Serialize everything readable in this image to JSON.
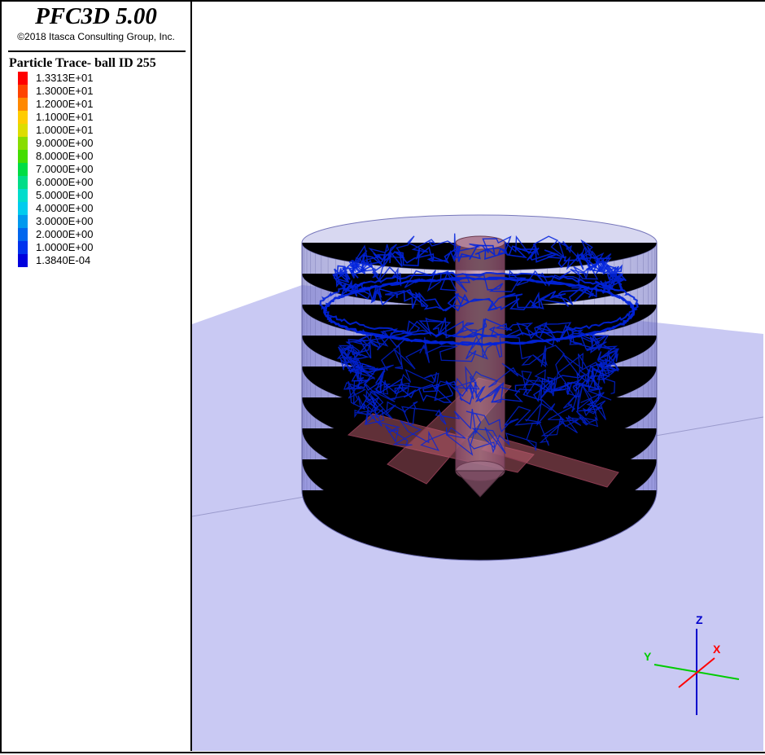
{
  "header": {
    "app_title": "PFC3D 5.00",
    "copyright": "©2018 Itasca Consulting Group, Inc."
  },
  "legend": {
    "title": "Particle Trace- ball  ID 255",
    "entries": [
      {
        "label": "1.3313E+01",
        "color": "#ff0000"
      },
      {
        "label": "1.3000E+01",
        "color": "#ff4400"
      },
      {
        "label": "1.2000E+01",
        "color": "#ff8800"
      },
      {
        "label": "1.1000E+01",
        "color": "#ffcc00"
      },
      {
        "label": "1.0000E+01",
        "color": "#dddd00"
      },
      {
        "label": "9.0000E+00",
        "color": "#88dd00"
      },
      {
        "label": "8.0000E+00",
        "color": "#44dd00"
      },
      {
        "label": "7.0000E+00",
        "color": "#00dd44"
      },
      {
        "label": "6.0000E+00",
        "color": "#00dd88"
      },
      {
        "label": "5.0000E+00",
        "color": "#00ddcc"
      },
      {
        "label": "4.0000E+00",
        "color": "#00ccee"
      },
      {
        "label": "3.0000E+00",
        "color": "#0099ee"
      },
      {
        "label": "2.0000E+00",
        "color": "#0066ee"
      },
      {
        "label": "1.0000E+00",
        "color": "#0033ee"
      },
      {
        "label": "1.3840E-04",
        "color": "#0000dd"
      }
    ]
  },
  "axes": {
    "x_label": "X",
    "y_label": "Y",
    "z_label": "Z",
    "x_color": "#ff0000",
    "y_color": "#00cc00",
    "z_color": "#0000cc"
  },
  "scene": {
    "plane_color": "#c8c8f4",
    "cylinder_color": "#7f7fcf",
    "trace_color": "#0022dd",
    "impeller_color": "#c06070"
  }
}
